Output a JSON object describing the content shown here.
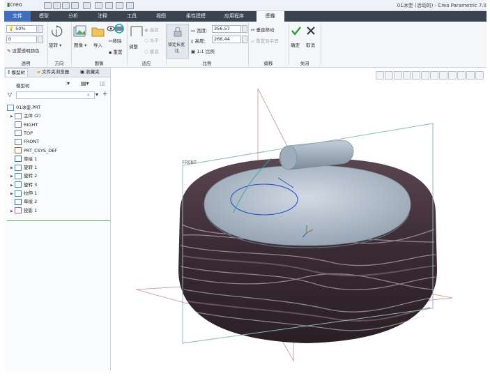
{
  "titlebar": {
    "logo": "creo",
    "window_title": "01冰壶 (活动的) - Creo Parametric 7.0"
  },
  "tabs": [
    {
      "label": "文件"
    },
    {
      "label": "模型"
    },
    {
      "label": "分析"
    },
    {
      "label": "注释"
    },
    {
      "label": "工具"
    },
    {
      "label": "视图"
    },
    {
      "label": "柔性建模"
    },
    {
      "label": "应用程序"
    },
    {
      "label": "图像"
    }
  ],
  "ribbon": {
    "transparency": {
      "opacity_value": "50%",
      "second_value": "0",
      "set_color": "设置透明颜色",
      "group": "透明"
    },
    "direction": {
      "rotate": "旋转",
      "group": "方向"
    },
    "image": {
      "image_btn": "图像",
      "import_btn": "导入",
      "remove_btn": "移除",
      "reset_btn": "重置",
      "group": "图像"
    },
    "adjust": {
      "adjust_btn": "调整",
      "flip": "曲前",
      "horizontal": "水平",
      "vertical": "垂直",
      "group": "适应"
    },
    "ratio": {
      "lock_aspect_line1": "锁定长宽",
      "lock_aspect_line2": "比",
      "width_label": "宽度:",
      "width_value": "356.57",
      "height_label": "高度:",
      "height_value": "266.44",
      "ratio_1to1": "1:1 比例",
      "group": "比例"
    },
    "offset": {
      "vertical_move": "垂直移动",
      "reset_plane": "重置到平面",
      "group": "偏移"
    },
    "close": {
      "confirm": "确定",
      "cancel": "取消",
      "group": "关闭"
    }
  },
  "panel": {
    "tabs": [
      {
        "label": "模型树"
      },
      {
        "label": "文件夹浏览器"
      },
      {
        "label": "收藏夹"
      }
    ],
    "tree_header": "模型树",
    "items": [
      {
        "label": "01冰壶.PRT",
        "icon": "part-icon",
        "expand": ""
      },
      {
        "label": "主体 (2)",
        "icon": "body-icon",
        "expand": "▶"
      },
      {
        "label": "RIGHT",
        "icon": "plane-icon",
        "expand": ""
      },
      {
        "label": "TOP",
        "icon": "plane-icon",
        "expand": ""
      },
      {
        "label": "FRONT",
        "icon": "plane-icon",
        "expand": ""
      },
      {
        "label": "PRT_CSYS_DEF",
        "icon": "csys-icon",
        "expand": ""
      },
      {
        "label": "草绘 1",
        "icon": "sketch-icon",
        "expand": ""
      },
      {
        "label": "旋转 1",
        "icon": "revolve-icon",
        "expand": "▶"
      },
      {
        "label": "旋转 2",
        "icon": "revolve-icon",
        "expand": "▶"
      },
      {
        "label": "旋转 3",
        "icon": "revolve-icon",
        "expand": "▶"
      },
      {
        "label": "拉伸 1",
        "icon": "extrude-icon",
        "expand": "▶"
      },
      {
        "label": "草绘 2",
        "icon": "sketch-icon",
        "expand": ""
      },
      {
        "label": "投影 1",
        "icon": "project-icon",
        "expand": "▶"
      }
    ]
  },
  "viewport": {
    "plane_label": "FRONT"
  },
  "colors": {
    "tab_bar": "#3a4350",
    "file_tab": "#3f6fbe",
    "confirm": "#2e9b3a",
    "cancel": "#333333",
    "datum_plane": "#8fb7bd",
    "granite_dark": "#3a2a33",
    "handle": "#a6b4c2"
  }
}
